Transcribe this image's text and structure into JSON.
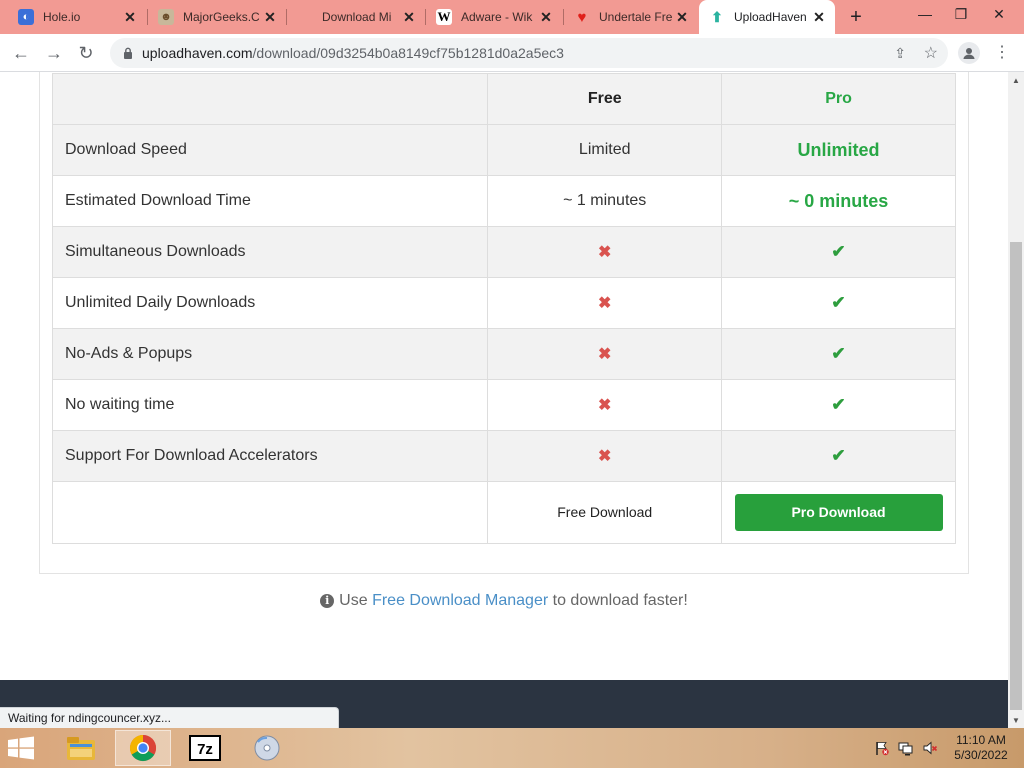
{
  "browser": {
    "tabs": [
      {
        "title": "Hole.io",
        "icon": "hole-io-icon"
      },
      {
        "title": "MajorGeeks.C",
        "icon": "majorgeeks-icon"
      },
      {
        "title": "Download Mi",
        "icon": "microsoft-icon"
      },
      {
        "title": "Adware - Wik",
        "icon": "wikipedia-icon"
      },
      {
        "title": "Undertale Fre",
        "icon": "undertale-icon"
      },
      {
        "title": "UploadHaven",
        "icon": "uploadhaven-icon"
      }
    ],
    "new_tab": "+",
    "url_host": "uploadhaven.com",
    "url_path": "/download/09d3254b0a8149cf75b1281d0a2a5ec3"
  },
  "table": {
    "headers": [
      "",
      "Free",
      "Pro"
    ],
    "rows": [
      {
        "feature": "Download Speed",
        "free": "Limited",
        "pro": "Unlimited"
      },
      {
        "feature": "Estimated Download Time",
        "free": "~ 1 minutes",
        "pro": "~ 0 minutes"
      },
      {
        "feature": "Simultaneous Downloads",
        "free": "✖",
        "pro": "✔"
      },
      {
        "feature": "Unlimited Daily Downloads",
        "free": "✖",
        "pro": "✔"
      },
      {
        "feature": "No-Ads & Popups",
        "free": "✖",
        "pro": "✔"
      },
      {
        "feature": "No waiting time",
        "free": "✖",
        "pro": "✔"
      },
      {
        "feature": "Support For Download Accelerators",
        "free": "✖",
        "pro": "✔"
      }
    ],
    "free_download_label": "Free Download",
    "pro_download_label": "Pro Download"
  },
  "hint": {
    "prefix": "Use",
    "link": "Free Download Manager",
    "suffix": "to download faster!"
  },
  "status_text": "Waiting for ndingcouncer.xyz...",
  "taskbar": {
    "apps": [
      "file-explorer-icon",
      "chrome-icon",
      "7zip-icon",
      "disc-burner-icon"
    ],
    "time": "11:10 AM",
    "date": "5/30/2022"
  },
  "colors": {
    "pro_green": "#28a745",
    "cross_red": "#d9534f",
    "link_blue": "#4a8fc7",
    "tabstrip": "#f29a93"
  }
}
